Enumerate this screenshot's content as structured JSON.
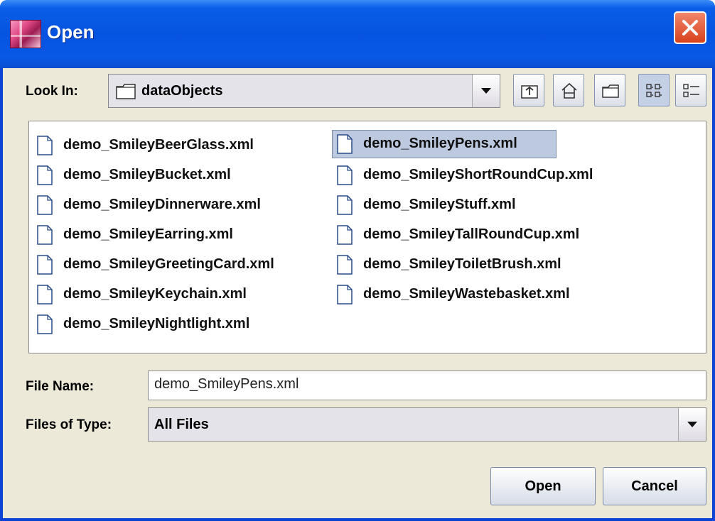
{
  "window": {
    "title": "Open"
  },
  "look_in": {
    "label": "Look In:",
    "value": "dataObjects",
    "toolbar": [
      {
        "name": "up-one-level-button",
        "icon": "folder-up-icon"
      },
      {
        "name": "home-button",
        "icon": "home-icon"
      },
      {
        "name": "new-folder-button",
        "icon": "new-folder-icon"
      },
      {
        "name": "list-view-button",
        "icon": "list-view-icon",
        "active": true
      },
      {
        "name": "details-view-button",
        "icon": "details-view-icon"
      }
    ]
  },
  "files": {
    "column1": [
      "demo_SmileyBeerGlass.xml",
      "demo_SmileyBucket.xml",
      "demo_SmileyDinnerware.xml",
      "demo_SmileyEarring.xml",
      "demo_SmileyGreetingCard.xml",
      "demo_SmileyKeychain.xml",
      "demo_SmileyNightlight.xml"
    ],
    "column2": [
      "demo_SmileyPens.xml",
      "demo_SmileyShortRoundCup.xml",
      "demo_SmileyStuff.xml",
      "demo_SmileyTallRoundCup.xml",
      "demo_SmileyToiletBrush.xml",
      "demo_SmileyWastebasket.xml"
    ],
    "selected": "demo_SmileyPens.xml"
  },
  "file_name": {
    "label": "File Name:",
    "value": "demo_SmileyPens.xml"
  },
  "file_type": {
    "label": "Files of Type:",
    "value": "All Files"
  },
  "buttons": {
    "open": "Open",
    "cancel": "Cancel"
  },
  "colors": {
    "title_bar": "#0553e0",
    "selection": "#bcc9df",
    "dialog_bg": "#ece9d8"
  }
}
